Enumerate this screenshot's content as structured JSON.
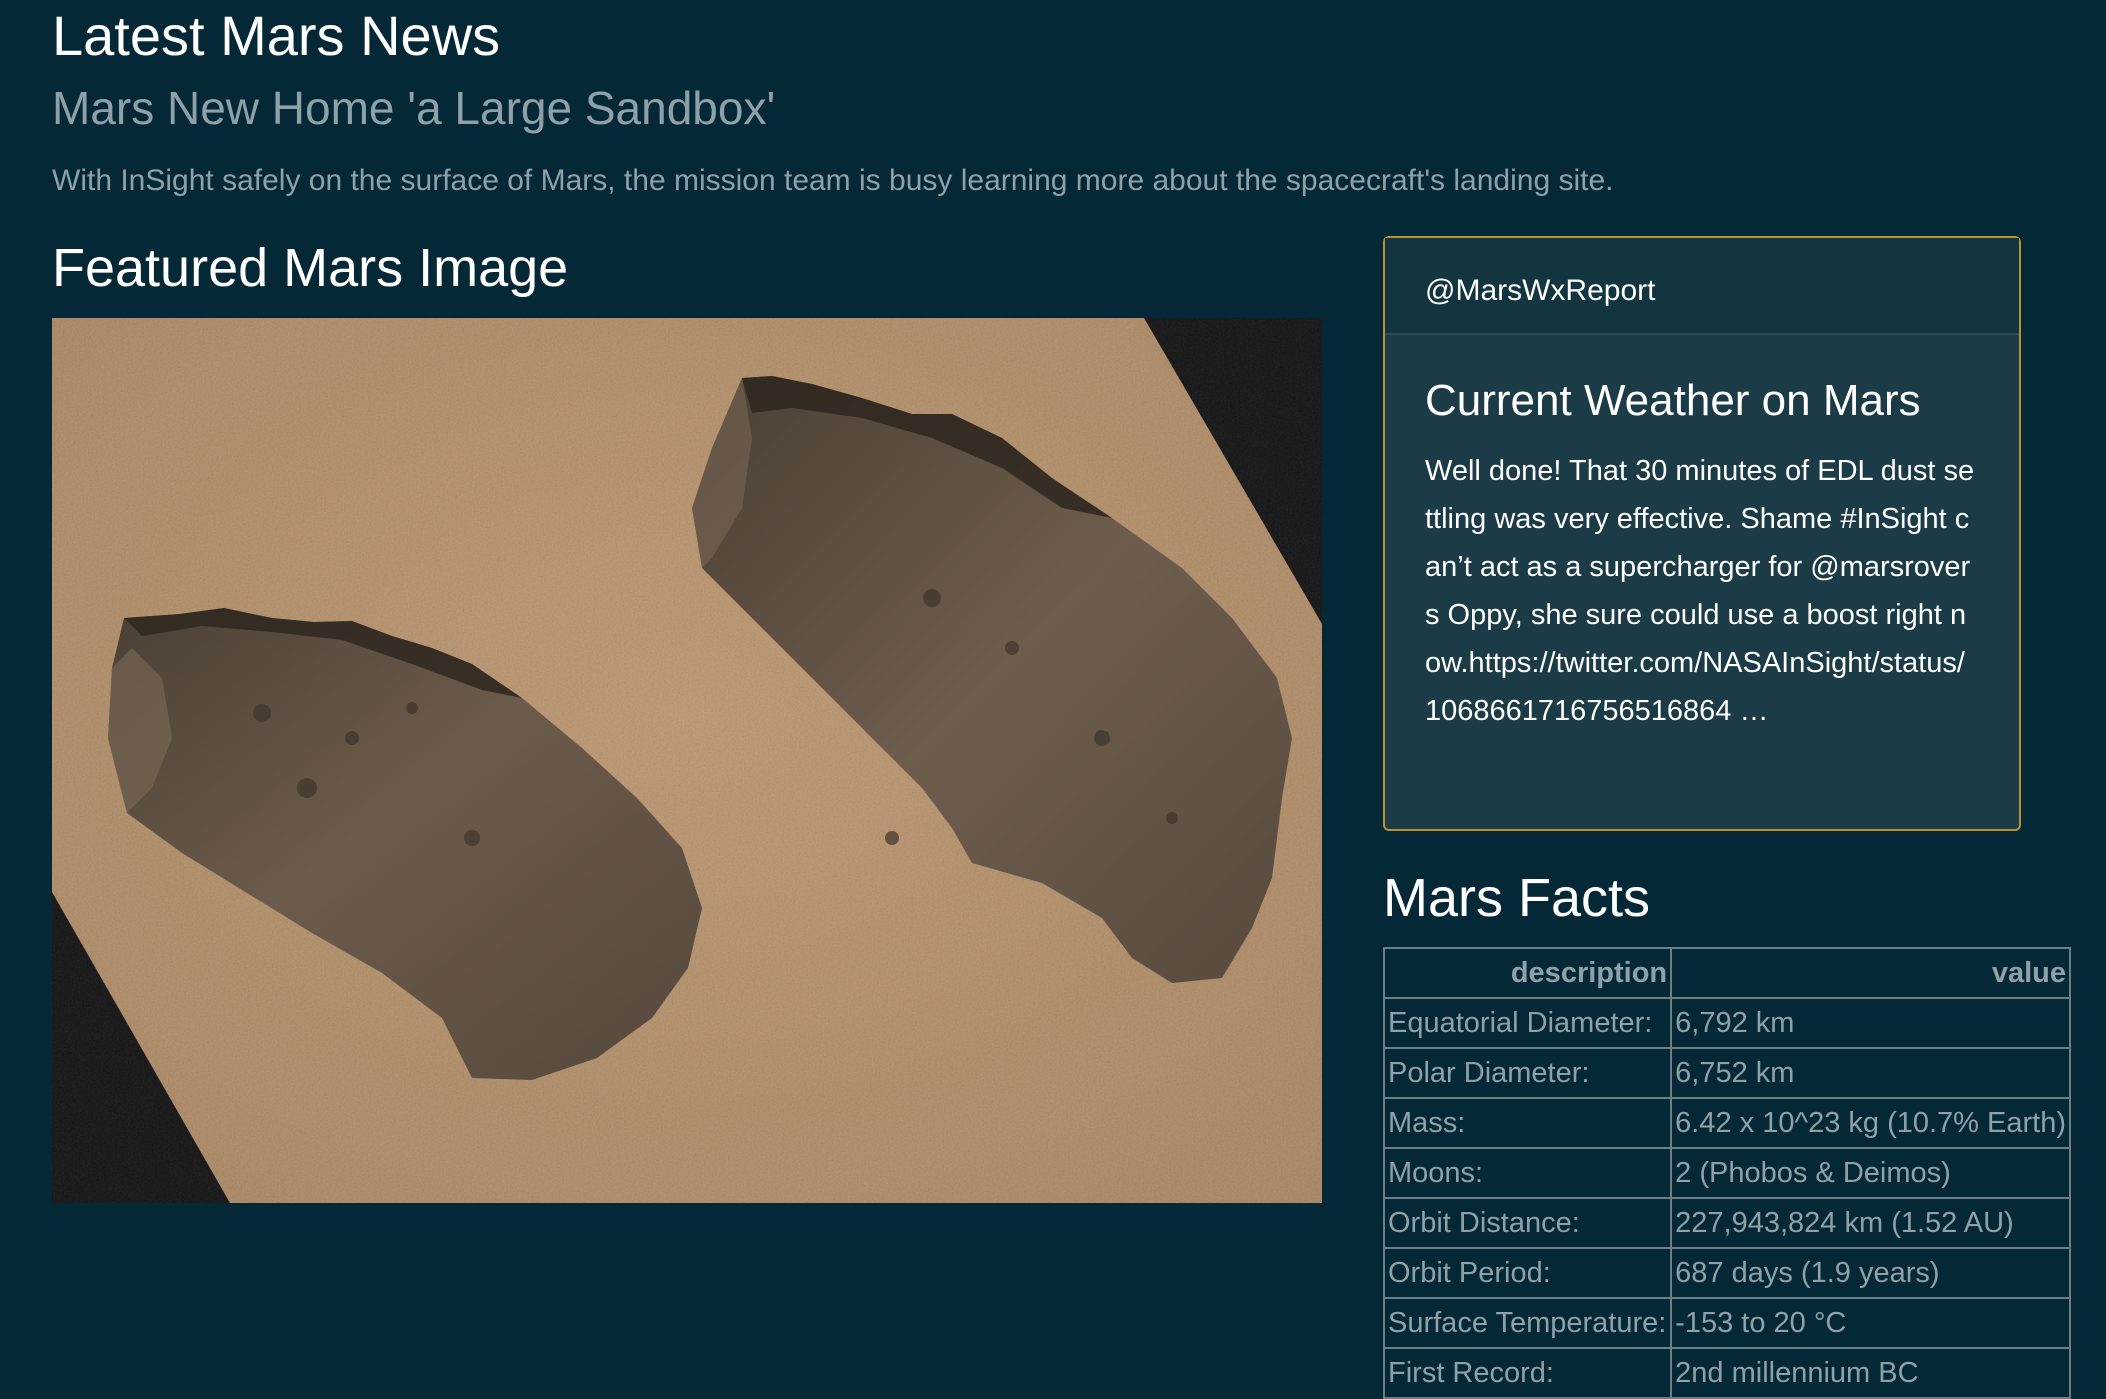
{
  "news": {
    "heading": "Latest Mars News",
    "title": "Mars New Home 'a Large Sandbox'",
    "teaser": "With InSight safely on the surface of Mars, the mission team is busy learning more about the spacecraft's landing site."
  },
  "featured": {
    "heading": "Featured Mars Image"
  },
  "weather": {
    "handle": "@MarsWxReport",
    "title": "Current Weather on Mars",
    "tweet": "Well done! That 30 minutes of EDL dust settling was very effective. Shame #InSight can’t act as a supercharger for @marsrovers Oppy, she sure could use a boost right now.https://twitter.com/NASAInSight/status/1068661716756516864 …"
  },
  "facts": {
    "heading": "Mars Facts",
    "columns": [
      "description",
      "value"
    ],
    "rows": [
      [
        "Equatorial Diameter:",
        "6,792 km"
      ],
      [
        "Polar Diameter:",
        "6,752 km"
      ],
      [
        "Mass:",
        "6.42 x 10^23 kg (10.7% Earth)"
      ],
      [
        "Moons:",
        "2 (Phobos & Deimos)"
      ],
      [
        "Orbit Distance:",
        "227,943,824 km (1.52 AU)"
      ],
      [
        "Orbit Period:",
        "687 days (1.9 years)"
      ],
      [
        "Surface Temperature:",
        "-153 to 20 °C"
      ],
      [
        "First Record:",
        "2nd millennium BC"
      ]
    ]
  },
  "colors": {
    "background": "#042835",
    "card_border": "#b7932d",
    "card_background": "#1b3c46",
    "muted_text": "#8fa1a8",
    "mars_soil": "#b38c62",
    "scoop": "#5e5144"
  }
}
